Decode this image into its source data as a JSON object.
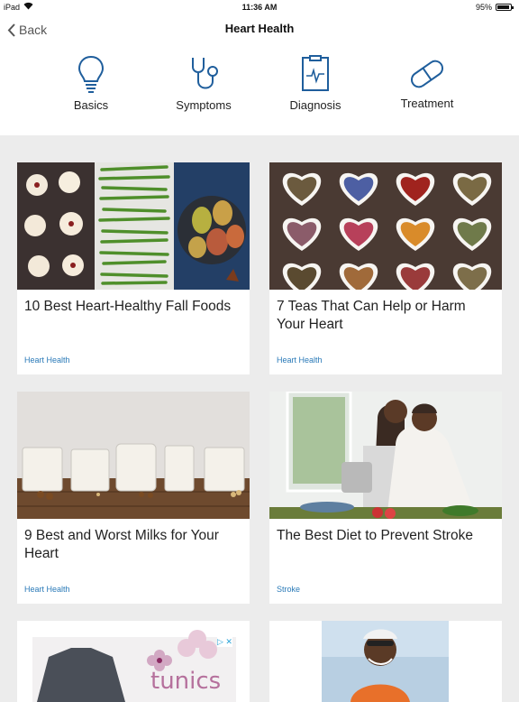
{
  "status": {
    "carrier": "iPad",
    "time": "11:36 AM",
    "battery": "95%",
    "battery_level": 0.95
  },
  "nav": {
    "back_label": "Back",
    "title": "Heart Health"
  },
  "topics": [
    {
      "label": "Basics",
      "icon": "lightbulb-icon"
    },
    {
      "label": "Symptoms",
      "icon": "stethoscope-icon"
    },
    {
      "label": "Diagnosis",
      "icon": "clipboard-ekg-icon"
    },
    {
      "label": "Treatment",
      "icon": "pill-capsule-icon"
    }
  ],
  "articles": [
    {
      "title": "10 Best Heart-Healthy Fall Foods",
      "tag": "Heart Health"
    },
    {
      "title": "7 Teas That Can Help or Harm Your Heart",
      "tag": "Heart Health"
    },
    {
      "title": "9 Best and Worst Milks for Your Heart",
      "tag": "Heart Health"
    },
    {
      "title": "The Best Diet to Prevent Stroke",
      "tag": "Stroke"
    }
  ],
  "ad": {
    "text": "tunics"
  },
  "colors": {
    "accent": "#2a7ab8",
    "icon": "#1f5e9c",
    "background": "#ececec"
  }
}
